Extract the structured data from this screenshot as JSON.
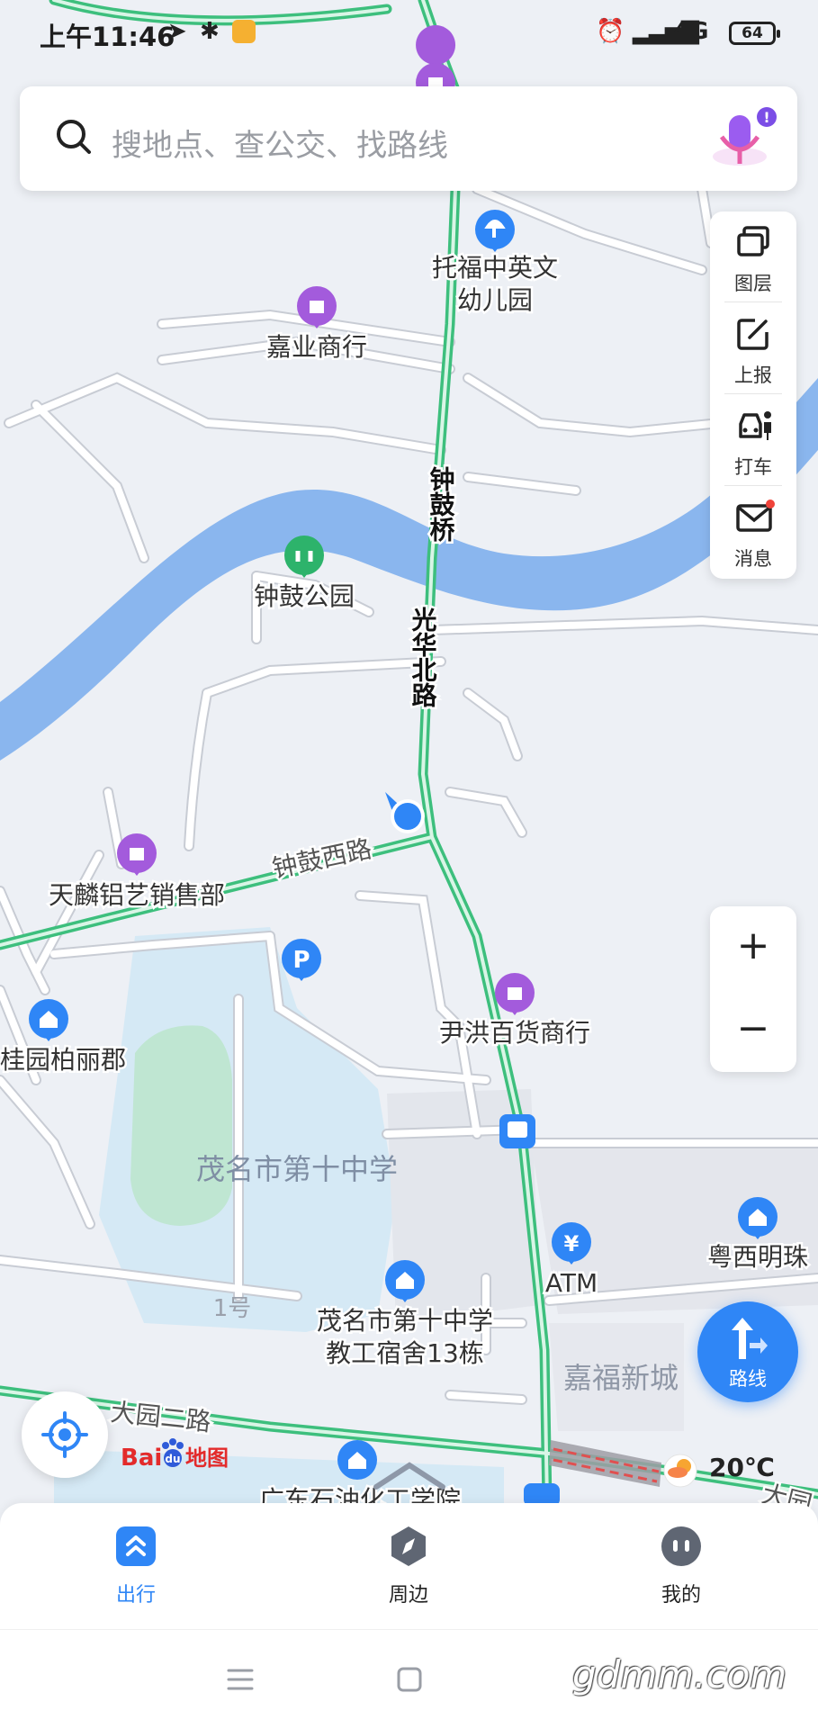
{
  "status_bar": {
    "time": "上午11:46",
    "network": "4G",
    "battery": "64"
  },
  "search": {
    "placeholder": "搜地点、查公交、找路线"
  },
  "side_panel": [
    {
      "label": "图层",
      "icon": "layers-icon"
    },
    {
      "label": "上报",
      "icon": "report-edit-icon"
    },
    {
      "label": "打车",
      "icon": "taxi-icon"
    },
    {
      "label": "消息",
      "icon": "message-envelope-icon"
    }
  ],
  "map": {
    "roads": {
      "zhonggu_bridge": "钟鼓桥",
      "guanghua_north": "光华北路",
      "zhonggu_west": "钟鼓西路",
      "dayuan_er": "大园二路",
      "dayuan_cut": "大园"
    },
    "pois": {
      "tuofu": [
        "托福中英文",
        "幼儿园"
      ],
      "jiaye": "嘉业商行",
      "zhonggu_park": "钟鼓公园",
      "tianlin": "天麟铝艺销售部",
      "guiyuan": "桂园柏丽郡",
      "yinhong": "尹洪百货商行",
      "school_area": "茂名市第十中学",
      "dorm": [
        "茂名市第十中学",
        "教工宿舍13栋"
      ],
      "atm": "ATM",
      "yuexi": "粤西明珠",
      "jiafu": "嘉福新城",
      "no1": "1号",
      "petro": "广东石油化工学院"
    }
  },
  "weather": {
    "temperature": "20℃"
  },
  "logo": {
    "text": "Baidu地图"
  },
  "controls": {
    "zoom_in": "+",
    "zoom_out": "−",
    "route_label": "路线"
  },
  "tabs": [
    {
      "label": "出行",
      "active": true
    },
    {
      "label": "周边",
      "active": false
    },
    {
      "label": "我的",
      "active": false
    }
  ],
  "watermark": "gdmm.com",
  "colors": {
    "accent": "#2f86f6",
    "road_green": "#3dbf7d",
    "river": "#8ab6ee",
    "poi_purple": "#a35bdc",
    "poi_blue": "#2f86f6",
    "park_green": "#2db36b"
  }
}
